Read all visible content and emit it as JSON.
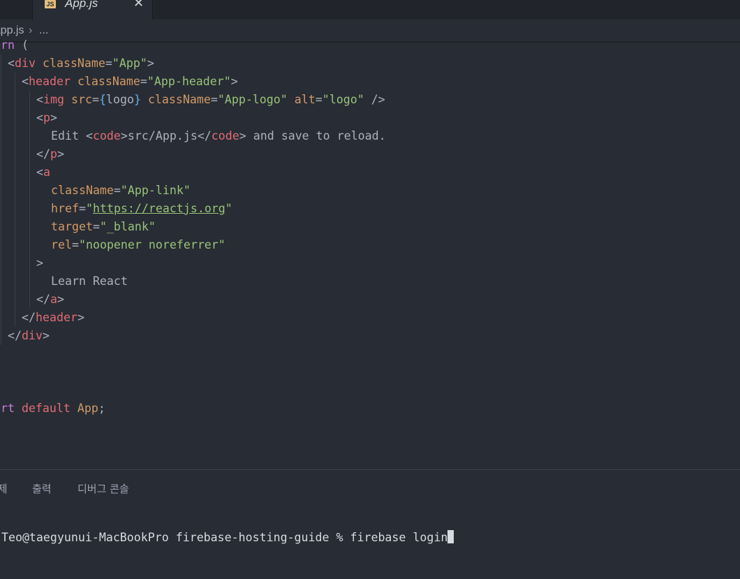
{
  "tab": {
    "badge": "JS",
    "title": "App.js",
    "close": "✕"
  },
  "breadcrumb": {
    "file": "App.js",
    "separator": "›",
    "more": "..."
  },
  "code": [
    [
      {
        "t": "return",
        "c": "kw"
      },
      {
        "t": " (",
        "c": "punct"
      }
    ],
    [
      {
        "t": "<",
        "c": "punct"
      },
      {
        "t": "div",
        "c": "tag"
      },
      {
        "t": " ",
        "c": "plain"
      },
      {
        "t": "className",
        "c": "attr"
      },
      {
        "t": "=",
        "c": "punct"
      },
      {
        "t": "\"App\"",
        "c": "str"
      },
      {
        "t": ">",
        "c": "punct"
      }
    ],
    [
      {
        "t": "<",
        "c": "punct"
      },
      {
        "t": "header",
        "c": "tag"
      },
      {
        "t": " ",
        "c": "plain"
      },
      {
        "t": "className",
        "c": "attr"
      },
      {
        "t": "=",
        "c": "punct"
      },
      {
        "t": "\"App-header\"",
        "c": "str"
      },
      {
        "t": ">",
        "c": "punct"
      }
    ],
    [
      {
        "t": "<",
        "c": "punct"
      },
      {
        "t": "img",
        "c": "tag"
      },
      {
        "t": " ",
        "c": "plain"
      },
      {
        "t": "src",
        "c": "attr"
      },
      {
        "t": "=",
        "c": "punct"
      },
      {
        "t": "{",
        "c": "brace"
      },
      {
        "t": "logo",
        "c": "plain"
      },
      {
        "t": "}",
        "c": "brace"
      },
      {
        "t": " ",
        "c": "plain"
      },
      {
        "t": "className",
        "c": "attr"
      },
      {
        "t": "=",
        "c": "punct"
      },
      {
        "t": "\"App-logo\"",
        "c": "str"
      },
      {
        "t": " ",
        "c": "plain"
      },
      {
        "t": "alt",
        "c": "attr"
      },
      {
        "t": "=",
        "c": "punct"
      },
      {
        "t": "\"logo\"",
        "c": "str"
      },
      {
        "t": " />",
        "c": "punct"
      }
    ],
    [
      {
        "t": "<",
        "c": "punct"
      },
      {
        "t": "p",
        "c": "tag"
      },
      {
        "t": ">",
        "c": "punct"
      }
    ],
    [
      {
        "t": "Edit <",
        "c": "plain"
      },
      {
        "t": "code",
        "c": "tag"
      },
      {
        "t": ">src/App.js</",
        "c": "plain"
      },
      {
        "t": "code",
        "c": "tag"
      },
      {
        "t": "> and save to reload.",
        "c": "plain"
      }
    ],
    [
      {
        "t": "</",
        "c": "punct"
      },
      {
        "t": "p",
        "c": "tag"
      },
      {
        "t": ">",
        "c": "punct"
      }
    ],
    [
      {
        "t": "<",
        "c": "punct"
      },
      {
        "t": "a",
        "c": "tag"
      }
    ],
    [
      {
        "t": "className",
        "c": "attr"
      },
      {
        "t": "=",
        "c": "punct"
      },
      {
        "t": "\"App-link\"",
        "c": "str"
      }
    ],
    [
      {
        "t": "href",
        "c": "attr"
      },
      {
        "t": "=",
        "c": "punct"
      },
      {
        "t": "\"",
        "c": "str"
      },
      {
        "t": "https://reactjs.org",
        "c": "str url"
      },
      {
        "t": "\"",
        "c": "str"
      }
    ],
    [
      {
        "t": "target",
        "c": "attr"
      },
      {
        "t": "=",
        "c": "punct"
      },
      {
        "t": "\"_blank\"",
        "c": "str"
      }
    ],
    [
      {
        "t": "rel",
        "c": "attr"
      },
      {
        "t": "=",
        "c": "punct"
      },
      {
        "t": "\"noopener noreferrer\"",
        "c": "str"
      }
    ],
    [
      {
        "t": ">",
        "c": "punct"
      }
    ],
    [
      {
        "t": "Learn React",
        "c": "plain"
      }
    ],
    [
      {
        "t": "</",
        "c": "punct"
      },
      {
        "t": "a",
        "c": "tag"
      },
      {
        "t": ">",
        "c": "punct"
      }
    ],
    [
      {
        "t": "</",
        "c": "punct"
      },
      {
        "t": "header",
        "c": "tag"
      },
      {
        "t": ">",
        "c": "punct"
      }
    ],
    [
      {
        "t": "</",
        "c": "punct"
      },
      {
        "t": "div",
        "c": "tag"
      },
      {
        "t": ">",
        "c": "punct"
      }
    ],
    [
      {
        "t": ");",
        "c": "punct"
      }
    ],
    [],
    [],
    [
      {
        "t": "export",
        "c": "kw"
      },
      {
        "t": " ",
        "c": "plain"
      },
      {
        "t": "default",
        "c": "tag"
      },
      {
        "t": " ",
        "c": "plain"
      },
      {
        "t": "App",
        "c": "attr"
      },
      {
        "t": ";",
        "c": "punct"
      }
    ]
  ],
  "panel": {
    "tabs": [
      "문제",
      "출력",
      "디버그 콘솔"
    ]
  },
  "terminal": {
    "line": "Teo@taegyunui-MacBookPro firebase-hosting-guide % firebase login"
  },
  "colors": {
    "background": "#282c34",
    "keyword": "#c678dd",
    "tag": "#e06c75",
    "attribute": "#d19a66",
    "string": "#98c379",
    "js_badge": "#e5c07b"
  }
}
